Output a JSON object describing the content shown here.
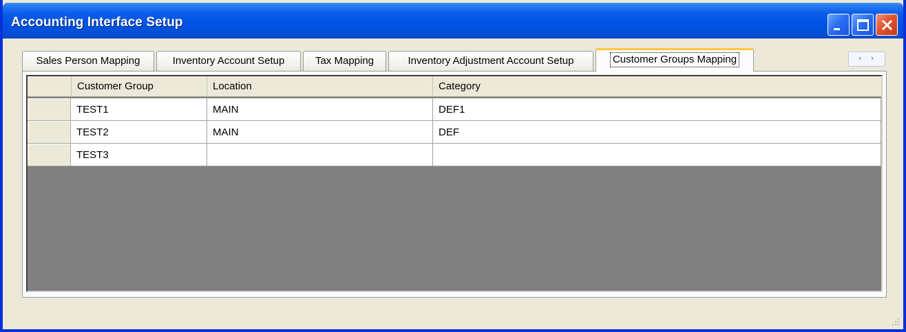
{
  "window": {
    "title": "Accounting Interface Setup",
    "controls": [
      "minimize-icon",
      "maximize-icon",
      "close-icon"
    ]
  },
  "tabs": [
    {
      "label": "Sales Person Mapping",
      "active": false
    },
    {
      "label": "Inventory Account Setup",
      "active": false
    },
    {
      "label": "Tax Mapping",
      "active": false
    },
    {
      "label": "Inventory Adjustment Account Setup",
      "active": false
    },
    {
      "label": "Customer Groups Mapping",
      "active": true
    }
  ],
  "tab_scroll": {
    "left": "‹",
    "right": "›"
  },
  "grid": {
    "columns": [
      "Customer Group",
      "Location",
      "Category"
    ],
    "rows": [
      [
        "TEST1",
        "MAIN",
        "DEF1"
      ],
      [
        "TEST2",
        "MAIN",
        "DEF"
      ],
      [
        "TEST3",
        "",
        ""
      ]
    ]
  },
  "colors": {
    "titlebar": "#0054e3",
    "window_face": "#ece9d8",
    "active_tab_accent": "#ffc83c",
    "grid_background": "#808080",
    "close_button": "#e2532f"
  }
}
